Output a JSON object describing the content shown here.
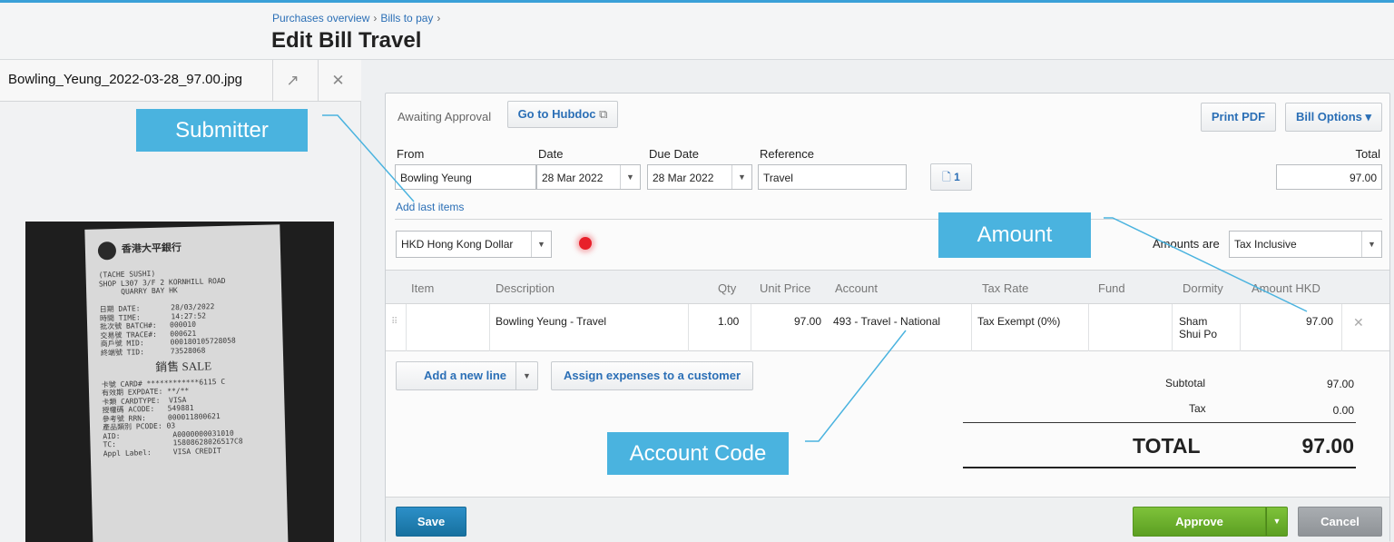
{
  "breadcrumbs": [
    "Purchases overview",
    "Bills to pay"
  ],
  "page_title": "Edit Bill Travel",
  "attachment": {
    "file_name": "Bowling_Yeung_2022-03-28_97.00.jpg",
    "receipt_lines": "(TACHE SUSHI)\nSHOP L307 3/F 2 KORNHILL ROAD\n     QUARRY BAY HK\n\n日期 DATE:       28/03/2022\n時間 TIME:       14:27:52\n批次號 BATCH#:   000010\n交易號 TRACE#:   000621\n商戶號 MID:      000180105728058\n終端號 TID:      73528068",
    "receipt_sale": "銷售 SALE",
    "receipt_lines_2": "卡號 CARD# ************6115 C\n有效期 EXPDATE: **/**\n卡類 CARDTYPE:  VISA\n授權碼 ACODE:   549881\n參考號 RRN:     000011800621\n產品類別 PCODE: 03\nAID:            A0000000031010\nTC:             15808628026517C8\nAppl Label:     VISA CREDIT",
    "receipt_bank": "香港大平銀行"
  },
  "status": "Awaiting Approval",
  "buttons": {
    "go_to_hubdoc": "Go to Hubdoc",
    "print_pdf": "Print PDF",
    "bill_options": "Bill Options ▾",
    "add_last_items": "Add last items",
    "add_new_line": "Add a new line",
    "assign_expenses": "Assign expenses to a customer",
    "save": "Save",
    "approve": "Approve",
    "cancel": "Cancel"
  },
  "form": {
    "from_label": "From",
    "from_value": "Bowling Yeung",
    "date_label": "Date",
    "date_value": "28 Mar 2022",
    "due_date_label": "Due Date",
    "due_date_value": "28 Mar 2022",
    "reference_label": "Reference",
    "reference_value": "Travel",
    "attachments_count": "1",
    "total_label": "Total",
    "total_value": "97.00",
    "currency_value": "HKD Hong Kong Dollar",
    "amounts_are_label": "Amounts are",
    "amounts_are_value": "Tax Inclusive"
  },
  "table": {
    "headers": [
      "Item",
      "Description",
      "Qty",
      "Unit Price",
      "Account",
      "Tax Rate",
      "Fund",
      "Dormity",
      "Amount HKD"
    ],
    "rows": [
      {
        "item": "",
        "description": "Bowling Yeung - Travel",
        "qty": "1.00",
        "unit_price": "97.00",
        "account": "493 - Travel - National",
        "tax_rate": "Tax Exempt (0%)",
        "fund": "",
        "dormity": "Sham\nShui Po",
        "amount": "97.00"
      }
    ]
  },
  "totals": {
    "subtotal_label": "Subtotal",
    "subtotal_value": "97.00",
    "tax_label": "Tax",
    "tax_value": "0.00",
    "total_label": "TOTAL",
    "total_value": "97.00"
  },
  "annotations": {
    "submitter": "Submitter",
    "amount": "Amount",
    "account_code": "Account Code"
  },
  "colors": {
    "link": "#2b6fb6",
    "callout": "#4ab3df",
    "save": "#1d7fb8",
    "approve": "#6fb12a",
    "cancel": "#9a9ea2"
  }
}
